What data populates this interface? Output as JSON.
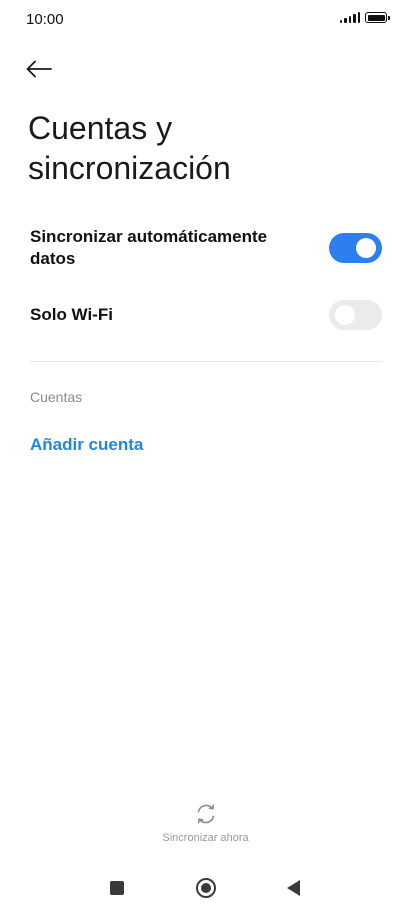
{
  "status_bar": {
    "time": "10:00",
    "signal_icon": "signal-icon",
    "battery_icon": "battery-icon"
  },
  "header": {
    "back_icon": "back-arrow-icon",
    "title": "Cuentas y sincronización"
  },
  "settings": [
    {
      "label": "Sincronizar automáticamente datos",
      "enabled": true
    },
    {
      "label": "Solo Wi-Fi",
      "enabled": false
    }
  ],
  "accounts": {
    "section_title": "Cuentas",
    "add_account_label": "Añadir cuenta"
  },
  "footer": {
    "sync_icon": "sync-icon",
    "sync_now_label": "Sincronizar ahora"
  },
  "nav_bar": {
    "recents_icon": "recents-icon",
    "home_icon": "home-icon",
    "back_icon": "back-icon"
  },
  "colors": {
    "accent": "#2d7ff0",
    "link": "#1f87e6",
    "toggle_off": "#ebebeb"
  }
}
